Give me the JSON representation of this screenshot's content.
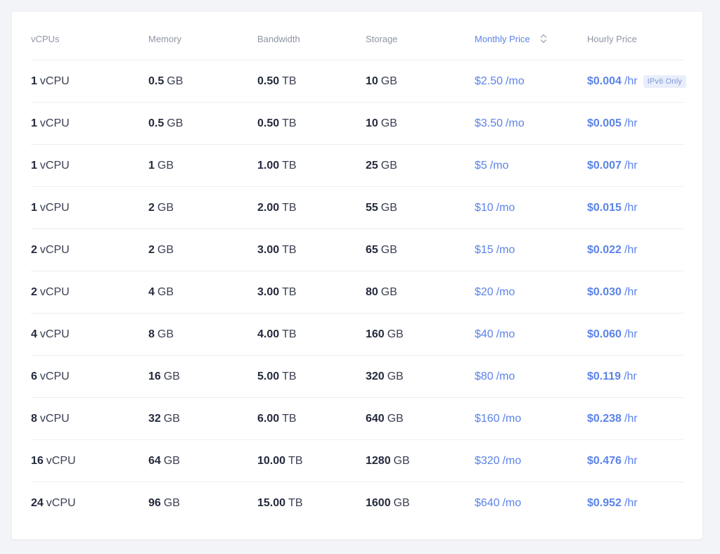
{
  "colors": {
    "accent": "#5b83e8",
    "text": "#2c3145",
    "header_text": "#8f95a6",
    "divider": "#eceef3",
    "badge_bg": "#e9eefb"
  },
  "table": {
    "headers": {
      "vcpus": "vCPUs",
      "memory": "Memory",
      "bandwidth": "Bandwidth",
      "storage": "Storage",
      "monthly_price": "Monthly Price",
      "hourly_price": "Hourly Price"
    },
    "sort_icon": "sort-updown-icon",
    "rows": [
      {
        "vcpu": "1",
        "vcpu_unit": "vCPU",
        "memory": "0.5",
        "memory_unit": "GB",
        "bandwidth": "0.50",
        "bandwidth_unit": "TB",
        "storage": "10",
        "storage_unit": "GB",
        "monthly": "$2.50",
        "monthly_unit": "/mo",
        "hourly": "$0.004",
        "hourly_unit": "/hr",
        "badge": "IPv6 Only"
      },
      {
        "vcpu": "1",
        "vcpu_unit": "vCPU",
        "memory": "0.5",
        "memory_unit": "GB",
        "bandwidth": "0.50",
        "bandwidth_unit": "TB",
        "storage": "10",
        "storage_unit": "GB",
        "monthly": "$3.50",
        "monthly_unit": "/mo",
        "hourly": "$0.005",
        "hourly_unit": "/hr"
      },
      {
        "vcpu": "1",
        "vcpu_unit": "vCPU",
        "memory": "1",
        "memory_unit": "GB",
        "bandwidth": "1.00",
        "bandwidth_unit": "TB",
        "storage": "25",
        "storage_unit": "GB",
        "monthly": "$5",
        "monthly_unit": "/mo",
        "hourly": "$0.007",
        "hourly_unit": "/hr"
      },
      {
        "vcpu": "1",
        "vcpu_unit": "vCPU",
        "memory": "2",
        "memory_unit": "GB",
        "bandwidth": "2.00",
        "bandwidth_unit": "TB",
        "storage": "55",
        "storage_unit": "GB",
        "monthly": "$10",
        "monthly_unit": "/mo",
        "hourly": "$0.015",
        "hourly_unit": "/hr"
      },
      {
        "vcpu": "2",
        "vcpu_unit": "vCPU",
        "memory": "2",
        "memory_unit": "GB",
        "bandwidth": "3.00",
        "bandwidth_unit": "TB",
        "storage": "65",
        "storage_unit": "GB",
        "monthly": "$15",
        "monthly_unit": "/mo",
        "hourly": "$0.022",
        "hourly_unit": "/hr"
      },
      {
        "vcpu": "2",
        "vcpu_unit": "vCPU",
        "memory": "4",
        "memory_unit": "GB",
        "bandwidth": "3.00",
        "bandwidth_unit": "TB",
        "storage": "80",
        "storage_unit": "GB",
        "monthly": "$20",
        "monthly_unit": "/mo",
        "hourly": "$0.030",
        "hourly_unit": "/hr"
      },
      {
        "vcpu": "4",
        "vcpu_unit": "vCPU",
        "memory": "8",
        "memory_unit": "GB",
        "bandwidth": "4.00",
        "bandwidth_unit": "TB",
        "storage": "160",
        "storage_unit": "GB",
        "monthly": "$40",
        "monthly_unit": "/mo",
        "hourly": "$0.060",
        "hourly_unit": "/hr"
      },
      {
        "vcpu": "6",
        "vcpu_unit": "vCPU",
        "memory": "16",
        "memory_unit": "GB",
        "bandwidth": "5.00",
        "bandwidth_unit": "TB",
        "storage": "320",
        "storage_unit": "GB",
        "monthly": "$80",
        "monthly_unit": "/mo",
        "hourly": "$0.119",
        "hourly_unit": "/hr"
      },
      {
        "vcpu": "8",
        "vcpu_unit": "vCPU",
        "memory": "32",
        "memory_unit": "GB",
        "bandwidth": "6.00",
        "bandwidth_unit": "TB",
        "storage": "640",
        "storage_unit": "GB",
        "monthly": "$160",
        "monthly_unit": "/mo",
        "hourly": "$0.238",
        "hourly_unit": "/hr"
      },
      {
        "vcpu": "16",
        "vcpu_unit": "vCPU",
        "memory": "64",
        "memory_unit": "GB",
        "bandwidth": "10.00",
        "bandwidth_unit": "TB",
        "storage": "1280",
        "storage_unit": "GB",
        "monthly": "$320",
        "monthly_unit": "/mo",
        "hourly": "$0.476",
        "hourly_unit": "/hr"
      },
      {
        "vcpu": "24",
        "vcpu_unit": "vCPU",
        "memory": "96",
        "memory_unit": "GB",
        "bandwidth": "15.00",
        "bandwidth_unit": "TB",
        "storage": "1600",
        "storage_unit": "GB",
        "monthly": "$640",
        "monthly_unit": "/mo",
        "hourly": "$0.952",
        "hourly_unit": "/hr"
      }
    ]
  }
}
